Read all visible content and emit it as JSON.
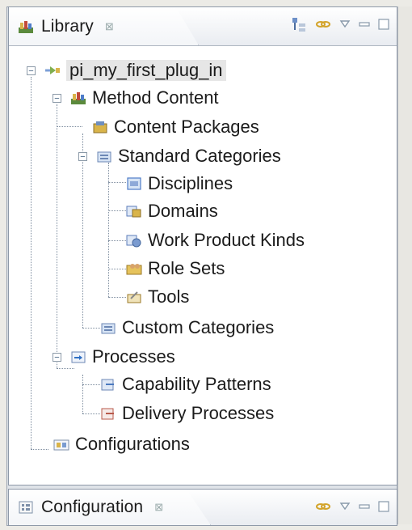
{
  "library": {
    "tab_label": "Library",
    "close_symbol": "⊠",
    "tree": {
      "root": "pi_my_first_plug_in",
      "method_content": "Method Content",
      "content_packages": "Content Packages",
      "standard_categories": "Standard Categories",
      "disciplines": "Disciplines",
      "domains": "Domains",
      "work_product_kinds": "Work Product Kinds",
      "role_sets": "Role Sets",
      "tools": "Tools",
      "custom_categories": "Custom Categories",
      "processes": "Processes",
      "capability_patterns": "Capability Patterns",
      "delivery_processes": "Delivery Processes",
      "configurations": "Configurations"
    }
  },
  "configuration": {
    "tab_label": "Configuration",
    "close_symbol": "⊠"
  },
  "icons": {
    "library": "library-icon",
    "configuration": "configuration-icon",
    "toolbar": [
      "expand-all-icon",
      "link-icon",
      "menu-icon",
      "minimize-icon",
      "maximize-icon"
    ]
  }
}
